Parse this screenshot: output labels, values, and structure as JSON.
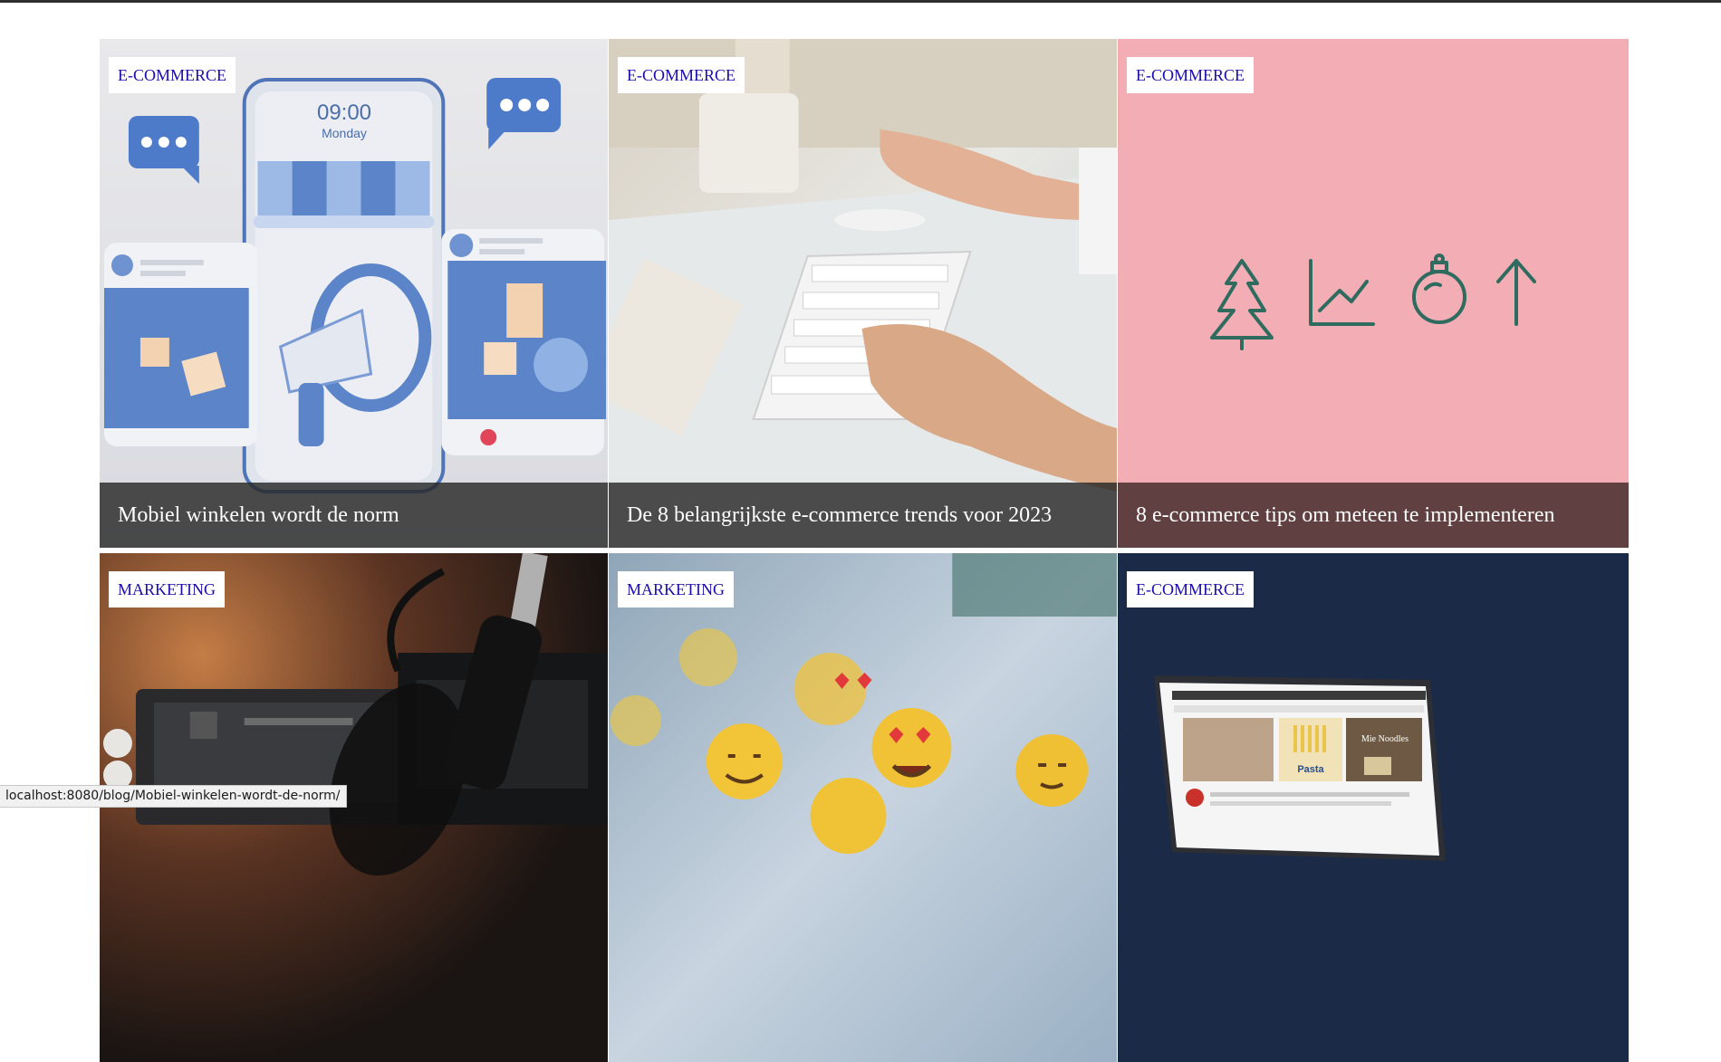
{
  "posts": [
    {
      "category": "E-COMMERCE",
      "title": "Mobiel winkelen wordt de norm"
    },
    {
      "category": "E-COMMERCE",
      "title": "De 8 belangrijkste e-commerce trends voor 2023"
    },
    {
      "category": "E-COMMERCE",
      "title": "8 e-commerce tips om meteen te implementeren"
    },
    {
      "category": "MARKETING",
      "title": ""
    },
    {
      "category": "MARKETING",
      "title": ""
    },
    {
      "category": "E-COMMERCE",
      "title": ""
    }
  ],
  "phone_mock": {
    "time": "09:00",
    "day": "Monday"
  },
  "laptop_mock": {
    "banner_text_1": "Pasta",
    "banner_text_2": "Mie Noodles"
  },
  "status_url": "localhost:8080/blog/Mobiel-winkelen-wordt-de-norm/",
  "colors": {
    "category_link": "#1a0dab",
    "caption_bg": "#3a3a3a",
    "pink_card": "#f2aeb4",
    "navy_card": "#1b2a47",
    "icon_green": "#2f6b5e"
  }
}
